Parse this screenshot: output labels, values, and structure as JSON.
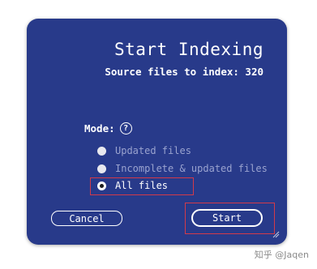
{
  "dialog": {
    "title": "Start Indexing",
    "subtitle": "Source files to index: 320",
    "mode_label": "Mode:",
    "help_icon": "question-circle-icon",
    "options": [
      {
        "label": "Updated files",
        "state": "disabled",
        "selected": false
      },
      {
        "label": "Incomplete & updated files",
        "state": "disabled",
        "selected": false
      },
      {
        "label": "All files",
        "state": "enabled",
        "selected": true
      }
    ],
    "cancel_label": "Cancel",
    "start_label": "Start"
  },
  "watermark": "知乎 @Jaqen",
  "colors": {
    "dialog_background": "#283a8a",
    "highlight": "#d23a4a",
    "disabled_text": "#9aa3cf"
  }
}
